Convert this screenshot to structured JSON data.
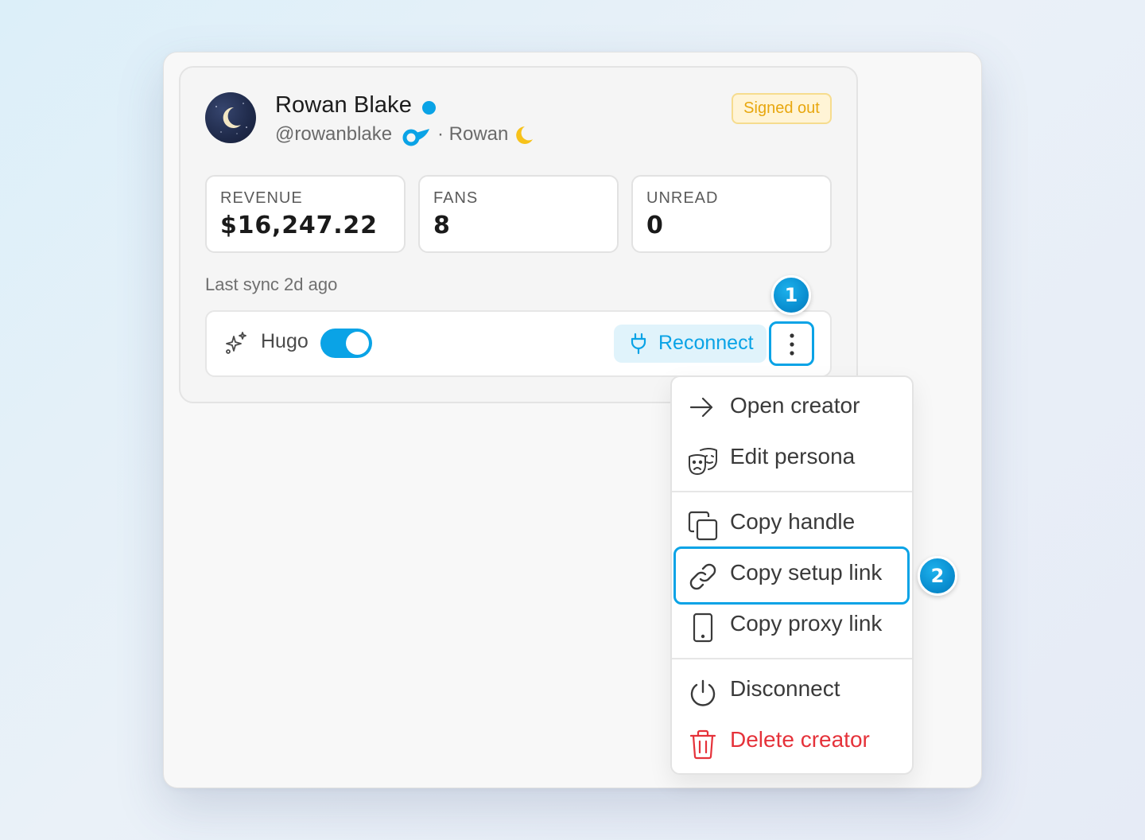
{
  "creator": {
    "name": "Rowan Blake",
    "handle": "@rowanblake",
    "display_name": "· Rowan",
    "status": "Signed out",
    "platform_icon": "onlyfans-icon"
  },
  "stats": [
    {
      "label": "REVENUE",
      "value": "$16,247.22"
    },
    {
      "label": "FANS",
      "value": "8"
    },
    {
      "label": "UNREAD",
      "value": "0"
    }
  ],
  "last_sync": "Last sync 2d ago",
  "ai": {
    "label": "Hugo",
    "enabled": true
  },
  "reconnect_label": "Reconnect",
  "steps": {
    "first": "1",
    "second": "2"
  },
  "menu": {
    "open_creator": "Open creator",
    "edit_persona": "Edit persona",
    "copy_handle": "Copy handle",
    "copy_setup_link": "Copy setup link",
    "copy_proxy_link": "Copy proxy link",
    "disconnect": "Disconnect",
    "delete_creator": "Delete creator"
  },
  "colors": {
    "accent": "#0aa3e6",
    "warning": "#e8a70e",
    "danger": "#e5323a"
  }
}
